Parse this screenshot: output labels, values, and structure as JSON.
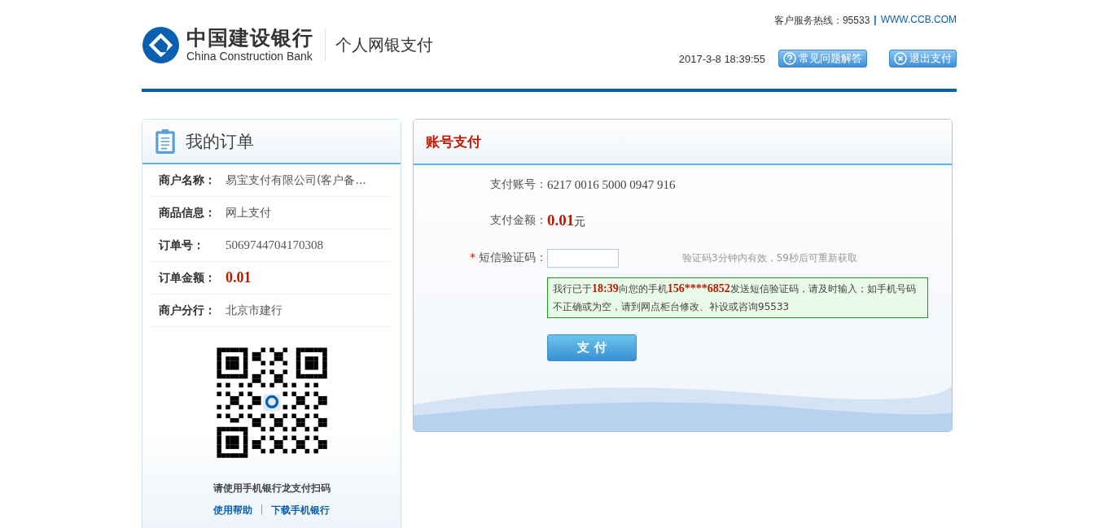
{
  "header": {
    "bank_name": "中国建设银行",
    "bank_name_en": "China Construction Bank",
    "product": "个人网银支付",
    "hotline": "客户服务热线：95533",
    "separator": "|",
    "website": "WWW.CCB.COM",
    "datetime": "2017-3-8 18:39:55",
    "buttons": [
      {
        "label": "常见问题解答",
        "kind": "help"
      },
      {
        "label": "退出支付",
        "kind": "exit"
      }
    ]
  },
  "order": {
    "title": "我的订单",
    "fields": [
      {
        "label": "商户名称：",
        "value": "易宝支付有限公司(客户备...",
        "kind": "text"
      },
      {
        "label": "商品信息：",
        "value": "网上支付",
        "kind": "text"
      },
      {
        "label": "订单号：",
        "value": "5069744704170308",
        "kind": "number"
      },
      {
        "label": "订单金额：",
        "value": "0.01",
        "kind": "amount"
      },
      {
        "label": "商户分行：",
        "value": "北京市建行",
        "kind": "text"
      }
    ],
    "qr_caption": "请使用手机银行龙支付扫码",
    "links": [
      "使用帮助",
      "下载手机银行"
    ],
    "link_separator": "|"
  },
  "payment": {
    "title": "账号支付",
    "account": {
      "label": "支付账号：",
      "value": "6217 0016 5000 0947 916"
    },
    "amount": {
      "label": "支付金额：",
      "value": "0.01",
      "unit": "元"
    },
    "sms": {
      "required_mark": "*",
      "label": "短信验证码：",
      "hint": "验证码3分钟内有效，59秒后可重新获取"
    },
    "notice": [
      {
        "text": "我行已于",
        "emphasis": false
      },
      {
        "text": "18:39",
        "emphasis": true
      },
      {
        "text": "向您的手机",
        "emphasis": false
      },
      {
        "text": "156****6852",
        "emphasis": true
      },
      {
        "text": "发送短信验证码，请及时输入；如手机号码不正确或为空，请到网点柜台修改、补设或咨询95533",
        "emphasis": false
      }
    ],
    "submit": "支 付"
  }
}
